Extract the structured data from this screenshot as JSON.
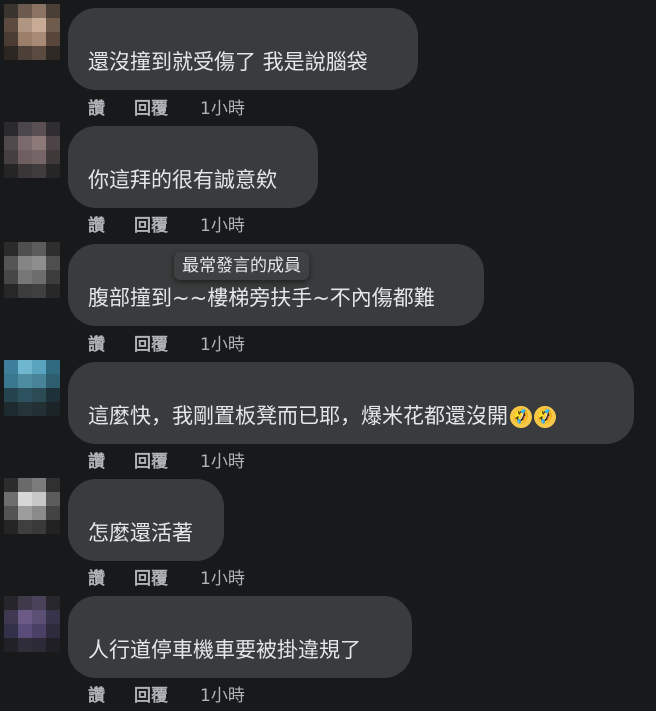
{
  "actions": {
    "like": "讚",
    "reply": "回覆"
  },
  "tooltip": "最常發言的成員",
  "comments": [
    {
      "text": "還沒撞到就受傷了 我是說腦袋",
      "time": "1小時"
    },
    {
      "text": "你這拜的很有誠意欸",
      "time": "1小時"
    },
    {
      "text": "腹部撞到~~樓梯旁扶手~不內傷都難",
      "time": "1小時"
    },
    {
      "text": "這麼快，我剛置板凳而已耶，爆米花都還沒開",
      "emojis": [
        "🤣",
        "🤣"
      ],
      "emoji_names": [
        "rolling-laughing-emoji",
        "rolling-laughing-emoji"
      ],
      "time": "1小時"
    },
    {
      "text": "怎麼還活著",
      "time": "1小時"
    },
    {
      "text": "人行道停車機車要被掛違規了",
      "time": "1小時"
    }
  ],
  "colors": {
    "background": "#18191a",
    "bubble": "#3a3b3c",
    "text": "#e4e6eb",
    "secondary_text": "#b0b3b8",
    "tooltip": "#3e4042"
  }
}
